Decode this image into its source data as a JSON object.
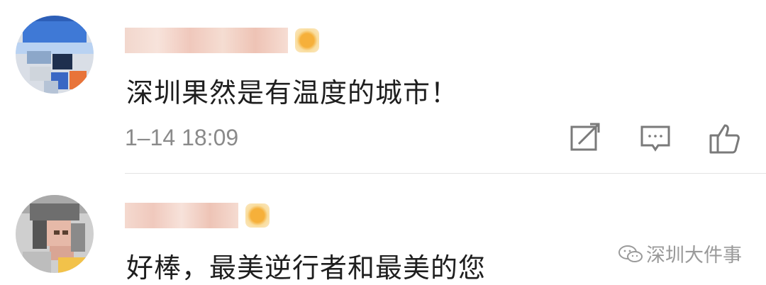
{
  "comments": [
    {
      "username": "",
      "text": "深圳果然是有温度的城市！",
      "timestamp": "1–14 18:09",
      "icons": [
        "repost-icon",
        "comment-icon",
        "like-icon"
      ]
    },
    {
      "username": "",
      "text": "好棒，最美逆行者和最美的您"
    }
  ],
  "watermark": {
    "text": "深圳大件事",
    "icon": "wechat-icon"
  },
  "colors": {
    "text": "#1e1e1e",
    "timestamp": "#8a8a8a",
    "icon_stroke": "#7a7a7a",
    "divider": "#e3e3e3"
  }
}
